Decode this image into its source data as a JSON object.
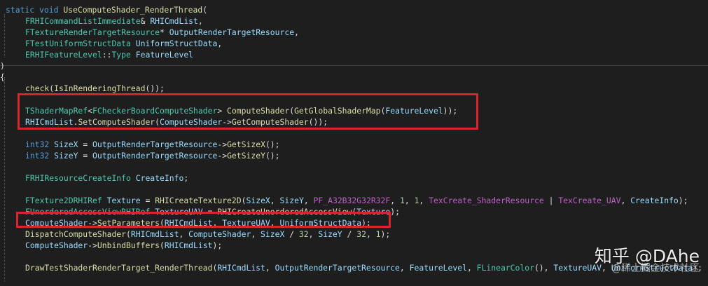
{
  "editor": {
    "colors": {
      "background": "#1e1e1e",
      "highlight_box": "#d9242b"
    },
    "lines": [
      [
        [
          "kw",
          "static "
        ],
        [
          "kw",
          "void "
        ],
        [
          "fn",
          "UseComputeShader_RenderThread"
        ],
        [
          "pl",
          "("
        ]
      ],
      [
        [
          "ty",
          "FRHICommandListImmediate"
        ],
        [
          "pl",
          "& "
        ],
        [
          "id",
          "RHICmdList"
        ],
        [
          "pl",
          ","
        ]
      ],
      [
        [
          "ty",
          "FTextureRenderTargetResource"
        ],
        [
          "pl",
          "* "
        ],
        [
          "id",
          "OutputRenderTargetResource"
        ],
        [
          "pl",
          ","
        ]
      ],
      [
        [
          "ty",
          "FTestUniformStructData "
        ],
        [
          "id",
          "UniformStructData"
        ],
        [
          "pl",
          ","
        ]
      ],
      [
        [
          "ty",
          "ERHIFeatureLevel"
        ],
        [
          "pl",
          "::"
        ],
        [
          "ty",
          "Type "
        ],
        [
          "id",
          "FeatureLevel"
        ]
      ],
      [
        [
          "pl",
          ")"
        ]
      ],
      [
        [
          "pl",
          "{"
        ]
      ],
      [
        [
          "fn",
          "check"
        ],
        [
          "pl",
          "("
        ],
        [
          "fn",
          "IsInRenderingThread"
        ],
        [
          "pl",
          "());"
        ]
      ],
      [],
      [
        [
          "ty",
          "TShaderMapRef"
        ],
        [
          "pl",
          "<"
        ],
        [
          "ty",
          "FCheckerBoardComputeShader"
        ],
        [
          "pl",
          "> "
        ],
        [
          "fn",
          "ComputeShader"
        ],
        [
          "pl",
          "("
        ],
        [
          "fn",
          "GetGlobalShaderMap"
        ],
        [
          "pl",
          "("
        ],
        [
          "id",
          "FeatureLevel"
        ],
        [
          "pl",
          "));"
        ]
      ],
      [
        [
          "id",
          "RHICmdList"
        ],
        [
          "pl",
          "."
        ],
        [
          "fn",
          "SetComputeShader"
        ],
        [
          "pl",
          "("
        ],
        [
          "id",
          "ComputeShader"
        ],
        [
          "pl",
          "->"
        ],
        [
          "fn",
          "GetComputeShader"
        ],
        [
          "pl",
          "());"
        ]
      ],
      [],
      [
        [
          "kw",
          "int32 "
        ],
        [
          "id",
          "SizeX "
        ],
        [
          "pl",
          "= "
        ],
        [
          "id",
          "OutputRenderTargetResource"
        ],
        [
          "pl",
          "->"
        ],
        [
          "fn",
          "GetSizeX"
        ],
        [
          "pl",
          "();"
        ]
      ],
      [
        [
          "kw",
          "int32 "
        ],
        [
          "id",
          "SizeY "
        ],
        [
          "pl",
          "= "
        ],
        [
          "id",
          "OutputRenderTargetResource"
        ],
        [
          "pl",
          "->"
        ],
        [
          "fn",
          "GetSizeY"
        ],
        [
          "pl",
          "();"
        ]
      ],
      [],
      [
        [
          "ty",
          "FRHIResourceCreateInfo "
        ],
        [
          "id",
          "CreateInfo"
        ],
        [
          "pl",
          ";"
        ]
      ],
      [],
      [
        [
          "ty",
          "FTexture2DRHIRef "
        ],
        [
          "id",
          "Texture "
        ],
        [
          "pl",
          "= "
        ],
        [
          "fn",
          "RHICreateTexture2D"
        ],
        [
          "pl",
          "("
        ],
        [
          "id",
          "SizeX"
        ],
        [
          "pl",
          ", "
        ],
        [
          "id",
          "SizeY"
        ],
        [
          "pl",
          ", "
        ],
        [
          "mc",
          "PF_A32B32G32R32F"
        ],
        [
          "pl",
          ", "
        ],
        [
          "nm",
          "1"
        ],
        [
          "pl",
          ", "
        ],
        [
          "nm",
          "1"
        ],
        [
          "pl",
          ", "
        ],
        [
          "mc",
          "TexCreate_ShaderResource "
        ],
        [
          "pl",
          "| "
        ],
        [
          "mc",
          "TexCreate_UAV"
        ],
        [
          "pl",
          ", "
        ],
        [
          "id",
          "CreateInfo"
        ],
        [
          "pl",
          ");"
        ]
      ],
      [
        [
          "ty",
          "FUnorderedAccessViewRHIRef "
        ],
        [
          "id",
          "TextureUAV "
        ],
        [
          "pl",
          "= "
        ],
        [
          "fn",
          "RHICreateUnorderedAccessView"
        ],
        [
          "pl",
          "("
        ],
        [
          "id",
          "Texture"
        ],
        [
          "pl",
          ");"
        ]
      ],
      [
        [
          "id",
          "ComputeShader"
        ],
        [
          "pl",
          "->"
        ],
        [
          "fn",
          "SetParameters"
        ],
        [
          "pl",
          "("
        ],
        [
          "id",
          "RHICmdList"
        ],
        [
          "pl",
          ", "
        ],
        [
          "id",
          "TextureUAV"
        ],
        [
          "pl",
          ", "
        ],
        [
          "id",
          "UniformStructData"
        ],
        [
          "pl",
          ");"
        ]
      ],
      [
        [
          "fn",
          "DispatchComputeShader"
        ],
        [
          "pl",
          "("
        ],
        [
          "id",
          "RHICmdList"
        ],
        [
          "pl",
          ", "
        ],
        [
          "id",
          "ComputeShader"
        ],
        [
          "pl",
          ", "
        ],
        [
          "id",
          "SizeX "
        ],
        [
          "pl",
          "/ "
        ],
        [
          "nm",
          "32"
        ],
        [
          "pl",
          ", "
        ],
        [
          "id",
          "SizeY "
        ],
        [
          "pl",
          "/ "
        ],
        [
          "nm",
          "32"
        ],
        [
          "pl",
          ", "
        ],
        [
          "nm",
          "1"
        ],
        [
          "pl",
          ");"
        ]
      ],
      [
        [
          "id",
          "ComputeShader"
        ],
        [
          "pl",
          "->"
        ],
        [
          "fn",
          "UnbindBuffers"
        ],
        [
          "pl",
          "("
        ],
        [
          "id",
          "RHICmdList"
        ],
        [
          "pl",
          ");"
        ]
      ],
      [],
      [
        [
          "fn",
          "DrawTestShaderRenderTarget_RenderThread"
        ],
        [
          "pl",
          "("
        ],
        [
          "id",
          "RHICmdList"
        ],
        [
          "pl",
          ", "
        ],
        [
          "id",
          "OutputRenderTargetResource"
        ],
        [
          "pl",
          ", "
        ],
        [
          "id",
          "FeatureLevel"
        ],
        [
          "pl",
          ", "
        ],
        [
          "ty",
          "FLinearColor"
        ],
        [
          "pl",
          "(), "
        ],
        [
          "id",
          "TextureUAV"
        ],
        [
          "pl",
          ", "
        ],
        [
          "id",
          "UniformStructData"
        ],
        [
          "pl",
          ");"
        ]
      ]
    ]
  },
  "watermark": {
    "main": "知乎 @DAhe",
    "secondary": "@稀土掘金技术社区"
  }
}
